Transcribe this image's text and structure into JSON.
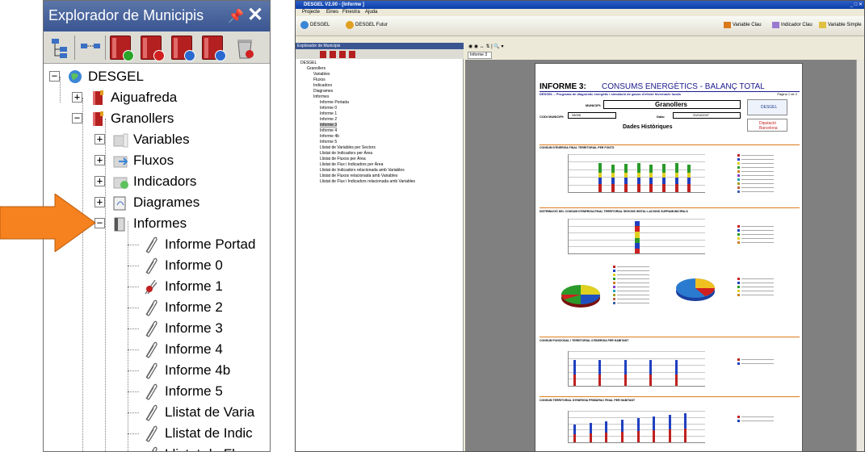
{
  "zoom": {
    "title": "Explorador de Municipis",
    "pin_glyph": "▀",
    "close_glyph": "✕",
    "toolbar_icons": [
      "tree-icon",
      "link-icon",
      "book-add-icon",
      "book-delete-icon",
      "book-edit-icon",
      "book-import-icon",
      "trash-icon"
    ],
    "tree": {
      "root": "DESGEL",
      "aiguafreda": "Aiguafreda",
      "granollers": "Granollers",
      "variables": "Variables",
      "fluxos": "Fluxos",
      "indicadors": "Indicadors",
      "diagrames": "Diagrames",
      "informes": "Informes",
      "reports": [
        "Informe Portad",
        "Informe 0",
        "Informe 1",
        "Informe 2",
        "Informe 3",
        "Informe 4",
        "Informe 4b",
        "Informe 5",
        "Llistat de Varia",
        "Llistat de Indic",
        "Llistat de Fluxo"
      ]
    }
  },
  "app": {
    "title": "DESGEL V2.00 - [Informe ]",
    "window_controls": "_ □ ✕",
    "menu": [
      "Projecte",
      "Eines",
      "Finestra",
      "Ajuda"
    ],
    "toolbar": {
      "desgel": "DESGEL",
      "desgel_futur": "DESGEL Futur",
      "variable_clau": "Variable Clau",
      "indicador_clau": "Indicador Clau",
      "variable_simple": "Variable Simple"
    },
    "explorer": {
      "title": "Explorador de Municipis",
      "items": [
        "DESGEL",
        "Granollers",
        "Variables",
        "Fluxos",
        "Indicadors",
        "Diagrames",
        "Informes",
        "Informe Portada",
        "Informe 0",
        "Informe 1",
        "Informe 2",
        "Informe 3",
        "Informe 4",
        "Informe 4b",
        "Informe 5",
        "Llistat de Variables per Sectors",
        "Llistat de Indicadors per Àrea",
        "Llistat de Fluxos per Àrea",
        "Llistat de Flux i Indicadors per Àrea",
        "Llistat de Indicadors relacionada amb Variables",
        "Llistat de Fluxos relacionada amb Variables",
        "Llistat de Flux i Indicadors relacionada amb Variables"
      ]
    },
    "doc_tab": "Informe 3",
    "report": {
      "title_left": "INFORME 3:",
      "title_right": "CONSUMS ENERGÈTICS - BALANÇ TOTAL",
      "subtitle": "DESGEL – Programa de diagnòstic energètic i simulació de gasos d'efecte hivernacle locals",
      "page": "Pàgina 1 de 2",
      "municipi_label": "MUNICIPI:",
      "municipi_value": "Granollers",
      "codi_label": "CODI MUNICIPI:",
      "codi_value": "08096",
      "data_label": "Data:",
      "data_value": "20/04/2007",
      "heading": "Dades Històriques",
      "logo_desgel": "DESGEL",
      "logo_diputacio": "Diputació Barcelona",
      "sections": [
        "CONSUM D'ENERGIA FINAL TERRITORIAL PER FONTS",
        "DISTRIBUCIÓ DEL CONSUM D'ENERGIA FINAL TERRITORIAL SEGONS INSTAL·LACIONS SUPRAMUNICIPALS",
        "CONSUM FUNCIONAL I TERRITORIAL D'ENERGIA PER HABITANT",
        "CONSUM TERRITORIAL D'ENERGIA PRIMÀRIA I FINAL PER HABITANT"
      ]
    }
  },
  "colors": {
    "orange": "#f5821f",
    "title_blue": "#3a5591",
    "report_blue": "#1a1a8c"
  }
}
